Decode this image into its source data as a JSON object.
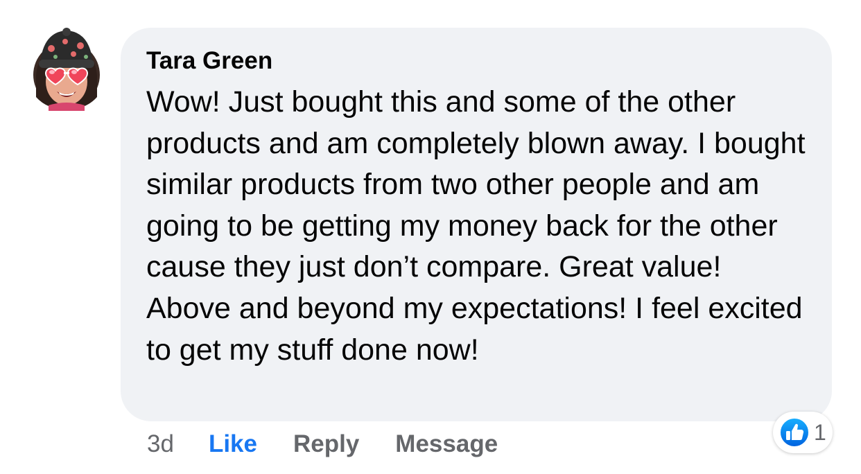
{
  "comment": {
    "author": "Tara Green",
    "text": "Wow! Just bought this and some of the other products and am completely blown away. I bought similar products from two other people and am going to be getting my money back for the other cause they just don’t compare. Great value! Above and beyond my expectations! I feel excited to get my stuff done now!",
    "time": "3d",
    "actions": {
      "like": "Like",
      "reply": "Reply",
      "message": "Message"
    },
    "reactions": {
      "icon": "like-icon",
      "count": "1"
    }
  },
  "colors": {
    "bubble": "#f0f2f5",
    "like_blue": "#1877f2",
    "secondary_text": "#65676b",
    "primary_text": "#050505"
  }
}
